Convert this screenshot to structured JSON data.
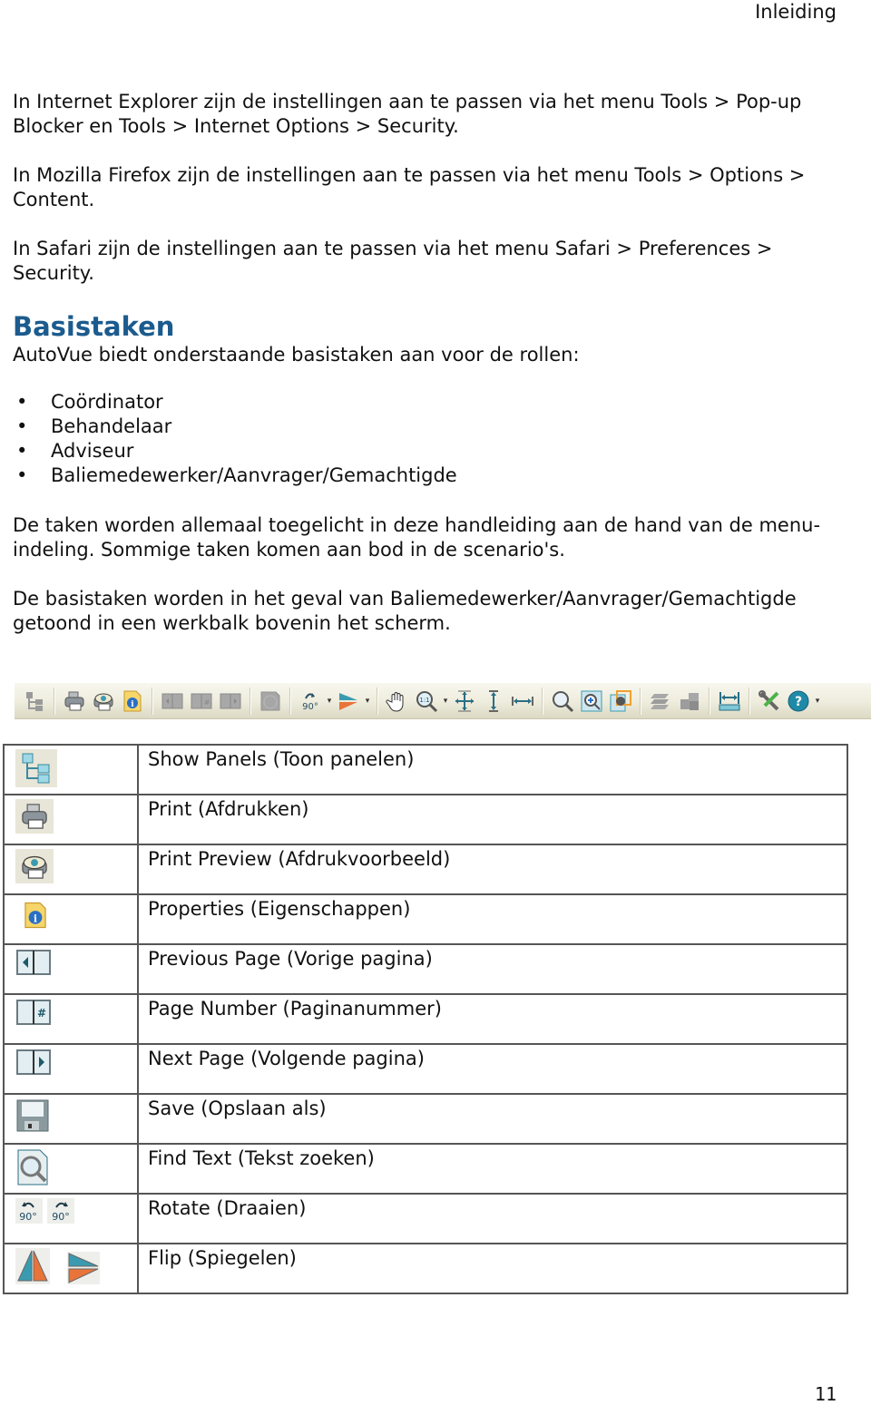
{
  "header": {
    "section_title": "Inleiding"
  },
  "paragraphs": {
    "ie": "In Internet Explorer zijn de instellingen aan te passen via het menu Tools > Pop-up Blocker en Tools > Internet Options > Security.",
    "firefox": "In Mozilla Firefox zijn de instellingen aan te passen via het menu Tools > Options > Content.",
    "safari": "In Safari zijn de instellingen aan te passen via het menu Safari > Preferences > Security."
  },
  "section": {
    "heading": "Basistaken",
    "intro": "AutoVue biedt onderstaande basistaken aan voor de rollen:",
    "roles": [
      "Coördinator",
      "Behandelaar",
      "Adviseur",
      "Baliemedewerker/Aanvrager/Gemachtigde"
    ],
    "bullet": "•",
    "text1": "De taken worden allemaal toegelicht in deze handleiding aan de hand van de menu-indeling. Sommige taken komen aan bod in de scenario's.",
    "text2": "De basistaken worden in het geval van Baliemedewerker/Aanvrager/Gemachtigde getoond in een werkbalk bovenin het scherm."
  },
  "toolbar": {
    "buttons": [
      {
        "name": "show-panels",
        "icon": "tree-panels-icon",
        "enabled": false
      },
      {
        "name": "print",
        "icon": "printer-icon",
        "enabled": true
      },
      {
        "name": "print-preview",
        "icon": "printer-eye-icon",
        "enabled": true
      },
      {
        "name": "properties",
        "icon": "info-document-icon",
        "enabled": true
      },
      {
        "name": "previous-page",
        "icon": "page-left-icon",
        "enabled": false
      },
      {
        "name": "page-number",
        "icon": "page-hash-icon",
        "enabled": false
      },
      {
        "name": "next-page",
        "icon": "page-right-icon",
        "enabled": false
      },
      {
        "name": "save",
        "icon": "save-icon",
        "enabled": false
      },
      {
        "name": "rotate",
        "icon": "rotate-90-icon",
        "enabled": true,
        "dropdown": true
      },
      {
        "name": "flip",
        "icon": "flip-icon",
        "enabled": true,
        "dropdown": true
      },
      {
        "name": "pan",
        "icon": "hand-icon",
        "enabled": true
      },
      {
        "name": "zoom-1-1",
        "icon": "zoom-1to1-icon",
        "enabled": true,
        "dropdown": true
      },
      {
        "name": "fit-page",
        "icon": "fit-all-icon",
        "enabled": true
      },
      {
        "name": "fit-height",
        "icon": "fit-height-icon",
        "enabled": true
      },
      {
        "name": "fit-width",
        "icon": "fit-width-icon",
        "enabled": true
      },
      {
        "name": "find-text",
        "icon": "magnifier-icon",
        "enabled": true
      },
      {
        "name": "zoom-window",
        "icon": "zoom-in-window-icon",
        "enabled": true
      },
      {
        "name": "zoom-area",
        "icon": "zoom-area-icon",
        "enabled": true
      },
      {
        "name": "layers",
        "icon": "layers-icon",
        "enabled": false
      },
      {
        "name": "blocks",
        "icon": "blocks-icon",
        "enabled": false
      },
      {
        "name": "measure",
        "icon": "measure-icon",
        "enabled": true
      },
      {
        "name": "tools",
        "icon": "tools-icon",
        "enabled": true
      },
      {
        "name": "help",
        "icon": "help-icon",
        "enabled": true,
        "dropdown": true
      }
    ],
    "dropdown_glyph": "▾",
    "rotate_label": "90°",
    "zoom_label": "1:1"
  },
  "table": {
    "rows": [
      {
        "icon": "tree-panels-icon",
        "label": "Show Panels (Toon panelen)"
      },
      {
        "icon": "printer-icon",
        "label": "Print (Afdrukken)"
      },
      {
        "icon": "printer-eye-icon",
        "label": "Print Preview (Afdrukvoorbeeld)"
      },
      {
        "icon": "info-document-icon",
        "label": "Properties (Eigenschappen)"
      },
      {
        "icon": "page-left-icon",
        "label": "Previous Page (Vorige pagina)"
      },
      {
        "icon": "page-hash-icon",
        "label": "Page Number (Paginanummer)"
      },
      {
        "icon": "page-right-icon",
        "label": "Next Page (Volgende pagina)"
      },
      {
        "icon": "save-icon",
        "label": "Save (Opslaan als)"
      },
      {
        "icon": "find-text-icon",
        "label": "Find Text (Tekst zoeken)"
      },
      {
        "icon": "rotate-icons",
        "label": "Rotate (Draaien)"
      },
      {
        "icon": "flip-icons",
        "label": "Flip (Spiegelen)"
      }
    ],
    "rotate_label": "90°",
    "page_hash": "#"
  },
  "footer": {
    "page_number": "11"
  },
  "colors": {
    "heading": "#1b5b8e",
    "icon_teal": "#3a9bb0",
    "icon_orange": "#e8743a",
    "toolbar_bg": "#efedde"
  }
}
